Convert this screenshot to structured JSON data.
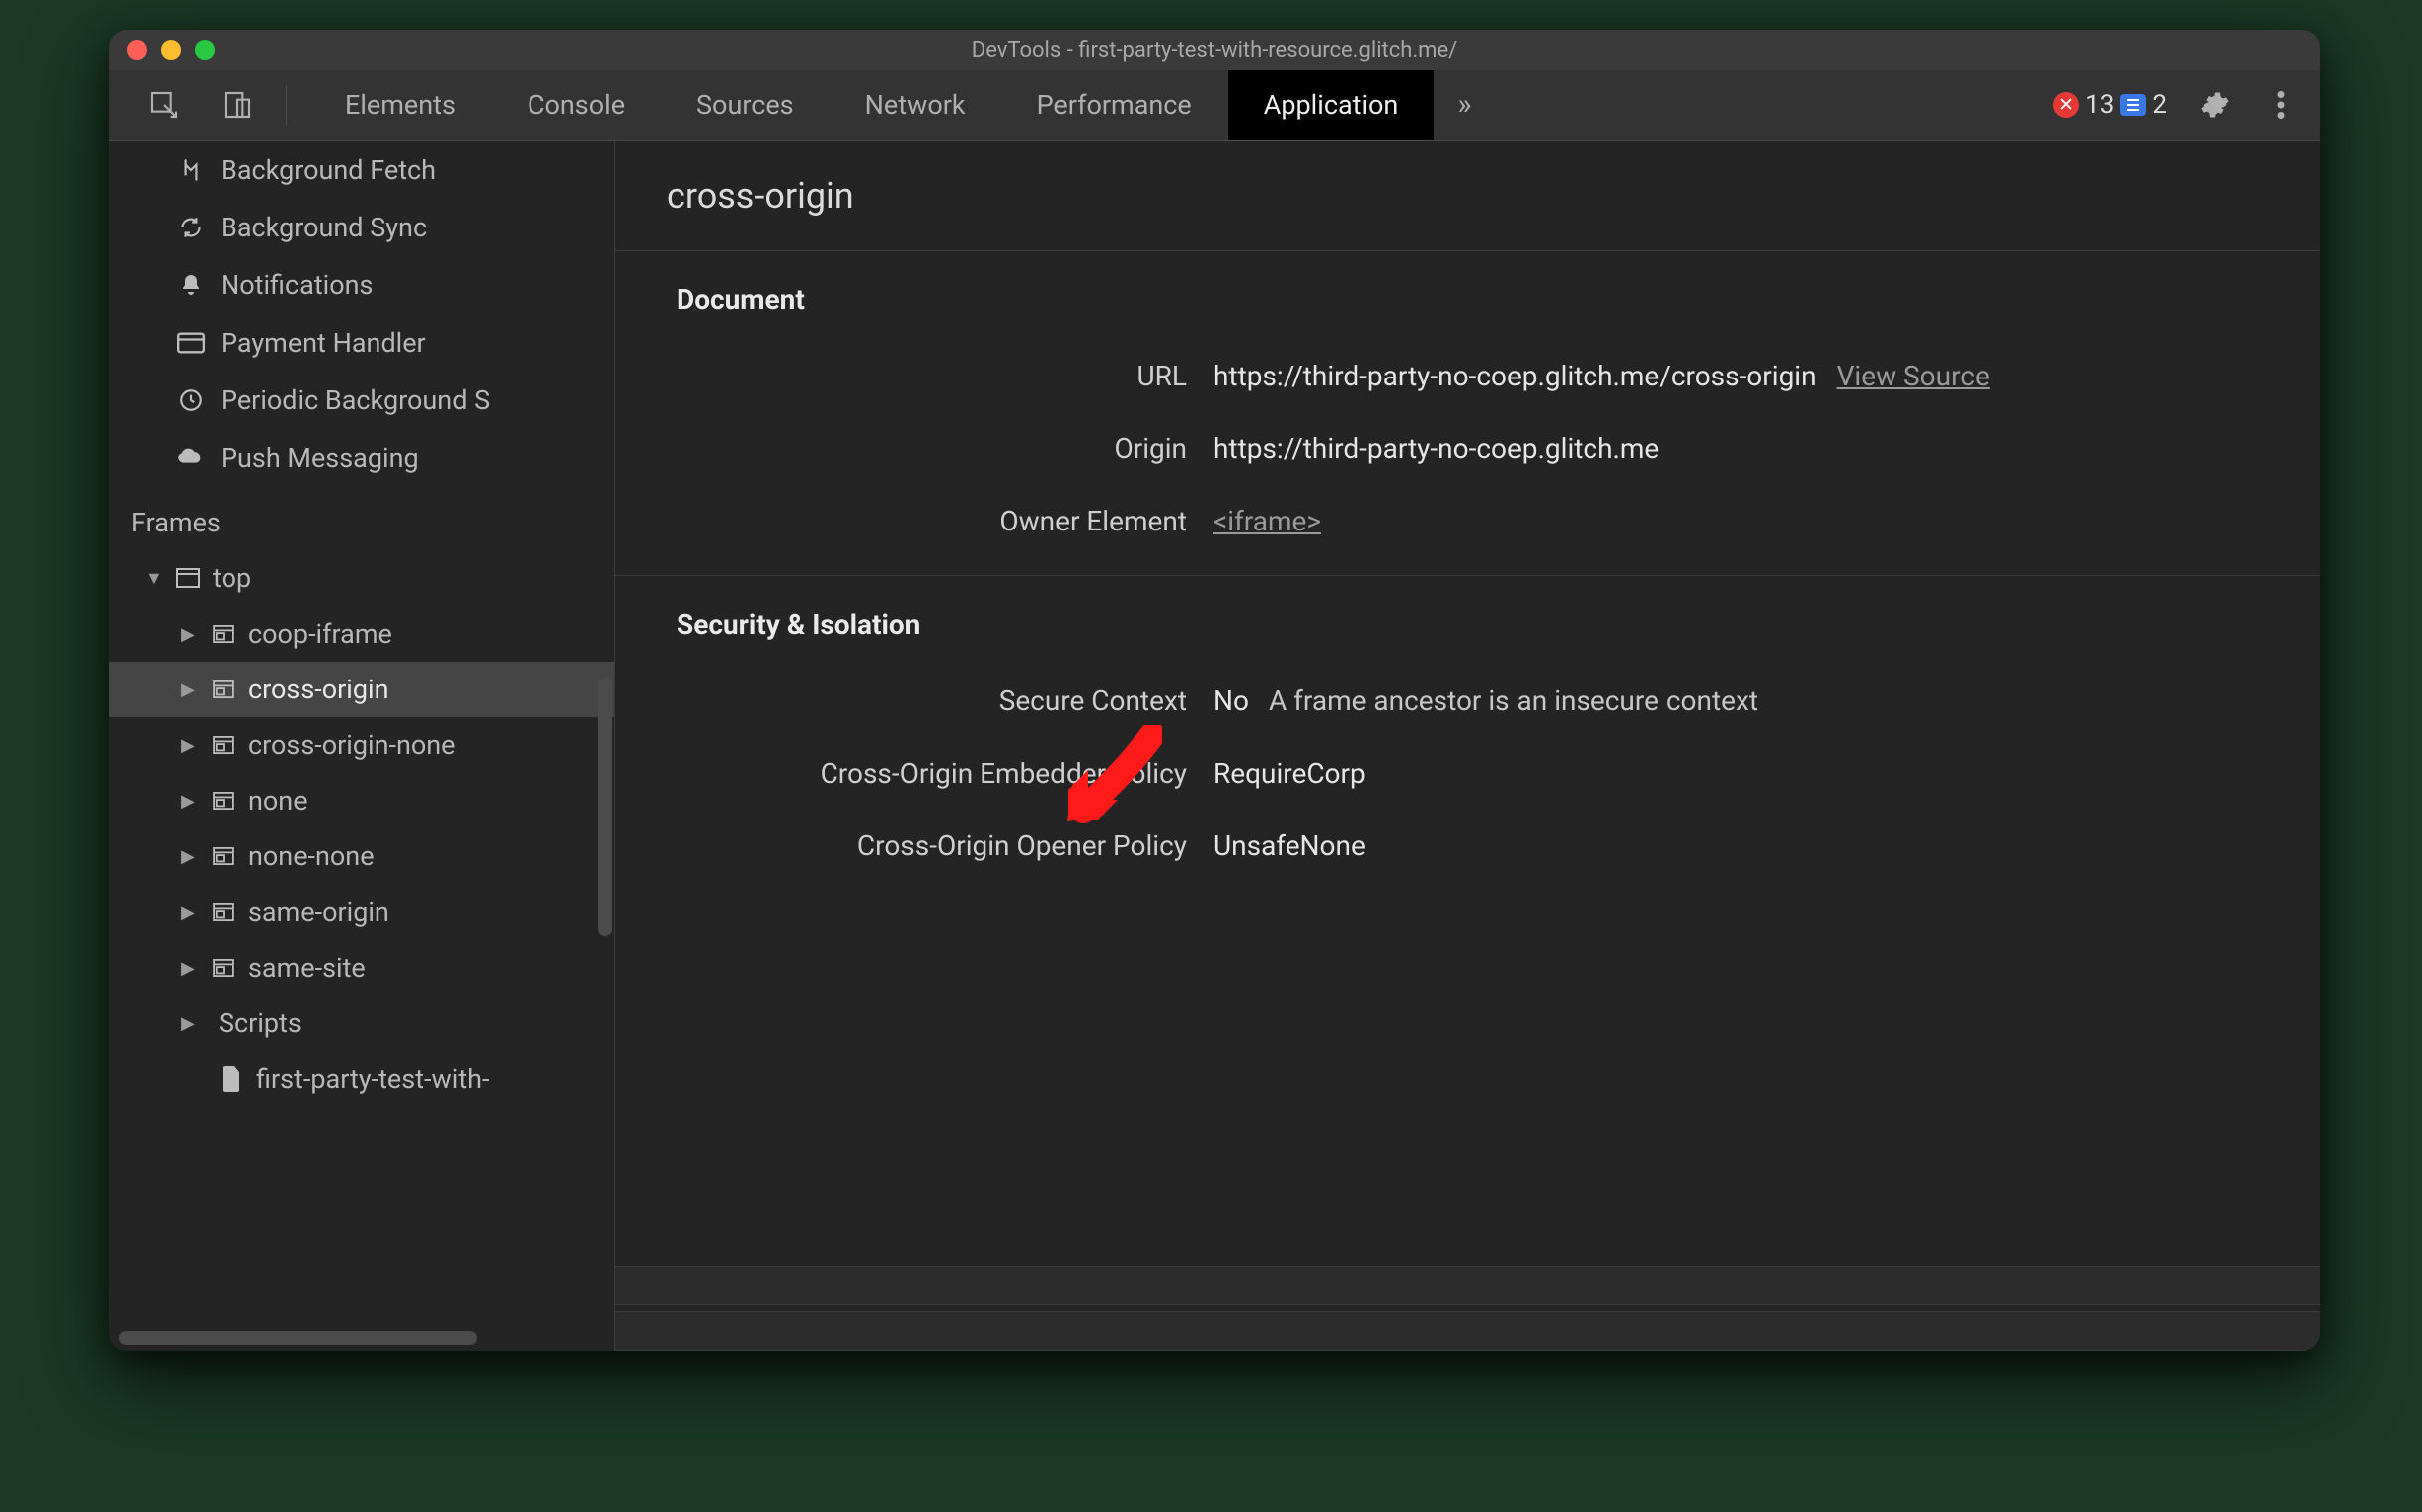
{
  "window": {
    "title": "DevTools - first-party-test-with-resource.glitch.me/"
  },
  "tabs": {
    "items": [
      "Elements",
      "Console",
      "Sources",
      "Network",
      "Performance",
      "Application"
    ],
    "active_index": 5,
    "overflow_glyph": "»",
    "errors_count": "13",
    "messages_count": "2",
    "errors_badge_glyph": "✕"
  },
  "sidebar": {
    "bg_items": [
      {
        "icon": "background-fetch-icon",
        "label": "Background Fetch"
      },
      {
        "icon": "background-sync-icon",
        "label": "Background Sync"
      },
      {
        "icon": "notifications-icon",
        "label": "Notifications"
      },
      {
        "icon": "payment-handler-icon",
        "label": "Payment Handler"
      },
      {
        "icon": "periodic-bg-sync-icon",
        "label": "Periodic Background S"
      },
      {
        "icon": "push-messaging-icon",
        "label": "Push Messaging"
      }
    ],
    "frames_heading": "Frames",
    "tree": {
      "root": {
        "label": "top",
        "expanded": true
      },
      "children": [
        {
          "label": "coop-iframe"
        },
        {
          "label": "cross-origin",
          "selected": true
        },
        {
          "label": "cross-origin-none"
        },
        {
          "label": "none"
        },
        {
          "label": "none-none"
        },
        {
          "label": "same-origin"
        },
        {
          "label": "same-site"
        },
        {
          "label": "Scripts",
          "type": "folder"
        },
        {
          "label": "first-party-test-with-",
          "type": "file"
        }
      ]
    }
  },
  "main": {
    "title": "cross-origin",
    "sections": [
      {
        "heading": "Document",
        "rows": [
          {
            "label": "URL",
            "value": "https://third-party-no-coep.glitch.me/cross-origin",
            "link_text": "View Source"
          },
          {
            "label": "Origin",
            "value": "https://third-party-no-coep.glitch.me"
          },
          {
            "label": "Owner Element",
            "link_value": "<iframe>"
          }
        ]
      },
      {
        "heading": "Security & Isolation",
        "rows": [
          {
            "label": "Secure Context",
            "value": "No",
            "sub": "A frame ancestor is an insecure context"
          },
          {
            "label": "Cross-Origin Embedder Policy",
            "value": "RequireCorp"
          },
          {
            "label": "Cross-Origin Opener Policy",
            "value": "UnsafeNone"
          }
        ]
      }
    ]
  }
}
